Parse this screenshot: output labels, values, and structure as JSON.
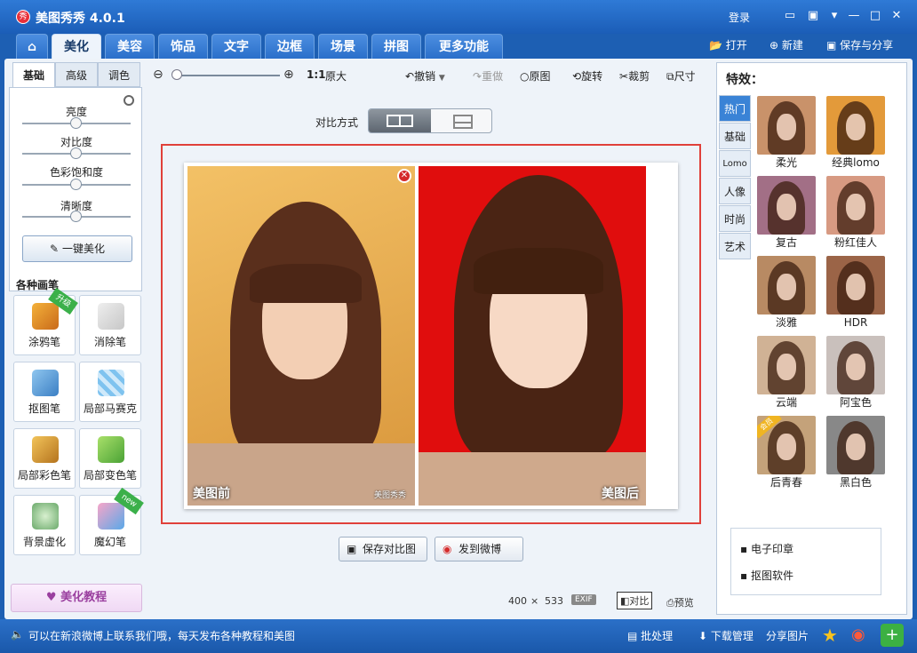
{
  "app": {
    "title": "美图秀秀 4.0.1",
    "login": "登录"
  },
  "tabs": [
    "美化",
    "美容",
    "饰品",
    "文字",
    "边框",
    "场景",
    "拼图",
    "更多功能"
  ],
  "top_actions": {
    "open": "打开",
    "new": "新建",
    "save_share": "保存与分享"
  },
  "left": {
    "subtabs": [
      "基础",
      "高级",
      "调色"
    ],
    "sliders": [
      "亮度",
      "对比度",
      "色彩饱和度",
      "清晰度"
    ],
    "one_key": "一键美化",
    "section_title": "各种画笔",
    "tools": [
      {
        "label": "涂鸦笔",
        "badge": "升级"
      },
      {
        "label": "消除笔",
        "badge": ""
      },
      {
        "label": "抠图笔",
        "badge": ""
      },
      {
        "label": "局部马赛克",
        "badge": ""
      },
      {
        "label": "局部彩色笔",
        "badge": ""
      },
      {
        "label": "局部变色笔",
        "badge": ""
      },
      {
        "label": "背景虚化",
        "badge": ""
      },
      {
        "label": "魔幻笔",
        "badge": "new"
      }
    ],
    "tutorial": "美化教程"
  },
  "toolbar": {
    "zoom_ratio": "1:1",
    "original_size": "原大",
    "undo": "撤销",
    "redo": "重做",
    "original": "原图",
    "rotate": "旋转",
    "crop": "裁剪",
    "size": "尺寸"
  },
  "compare": {
    "label": "对比方式"
  },
  "canvas": {
    "before_caption": "美图前",
    "after_caption": "美图后",
    "watermark": "美图秀秀"
  },
  "actions": {
    "save_compare": "保存对比图",
    "send_weibo": "发到微博"
  },
  "status": {
    "width": "400",
    "times": "×",
    "height": "533",
    "exif": "EXIF",
    "compare": "对比",
    "preview": "预览"
  },
  "right": {
    "title": "特效：",
    "vtabs": [
      "热门",
      "基础",
      "Lomo",
      "人像",
      "时尚",
      "艺术"
    ],
    "effects": [
      {
        "name": "柔光",
        "color": "#c9926a"
      },
      {
        "name": "经典lomo",
        "color": "#e39a3a"
      },
      {
        "name": "复古",
        "color": "#a26f86"
      },
      {
        "name": "粉红佳人",
        "color": "#d79a82"
      },
      {
        "name": "淡雅",
        "color": "#b88a63"
      },
      {
        "name": "HDR",
        "color": "#9b6447"
      },
      {
        "name": "云端",
        "color": "#d0b295"
      },
      {
        "name": "阿宝色",
        "color": "#c9c0bc"
      },
      {
        "name": "后青春",
        "color": "#c4a27a",
        "badge": "会员"
      },
      {
        "name": "黑白色",
        "color": "#888888"
      }
    ],
    "links": [
      "电子印章",
      "抠图软件"
    ]
  },
  "bottom": {
    "message": "可以在新浪微博上联系我们哦，每天发布各种教程和美图",
    "batch": "批处理",
    "download": "下载管理",
    "share": "分享图片"
  }
}
